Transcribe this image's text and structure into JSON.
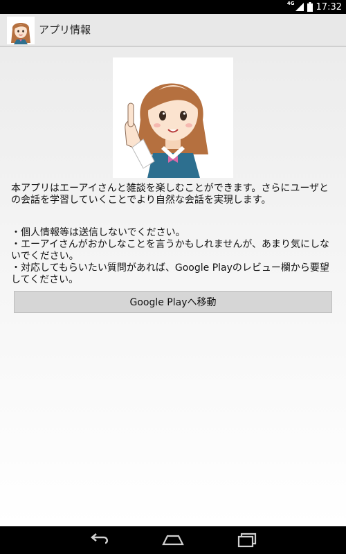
{
  "status_bar": {
    "network": "4G",
    "time": "17:32"
  },
  "action_bar": {
    "title": "アプリ情報"
  },
  "content": {
    "description": "本アプリはエーアイさんと雑談を楽しむことができます。さらにユーザとの会話を学習していくことでより自然な会話を実現します。",
    "notes": [
      "・個人情報等は送信しないでください。",
      "・エーアイさんがおかしなことを言うかもしれませんが、あまり気にしないでください。",
      "・対応してもらいたい質問があれば、Google Playのレビュー欄から要望してください。"
    ],
    "button_label": "Google Playへ移動"
  },
  "icons": {
    "signal": "signal-icon",
    "battery": "battery-icon",
    "back": "back-icon",
    "home": "home-icon",
    "recent": "recent-apps-icon"
  },
  "colors": {
    "action_bar": "#e8e8e8",
    "button": "#d6d6d6",
    "system_bars": "#000000"
  }
}
